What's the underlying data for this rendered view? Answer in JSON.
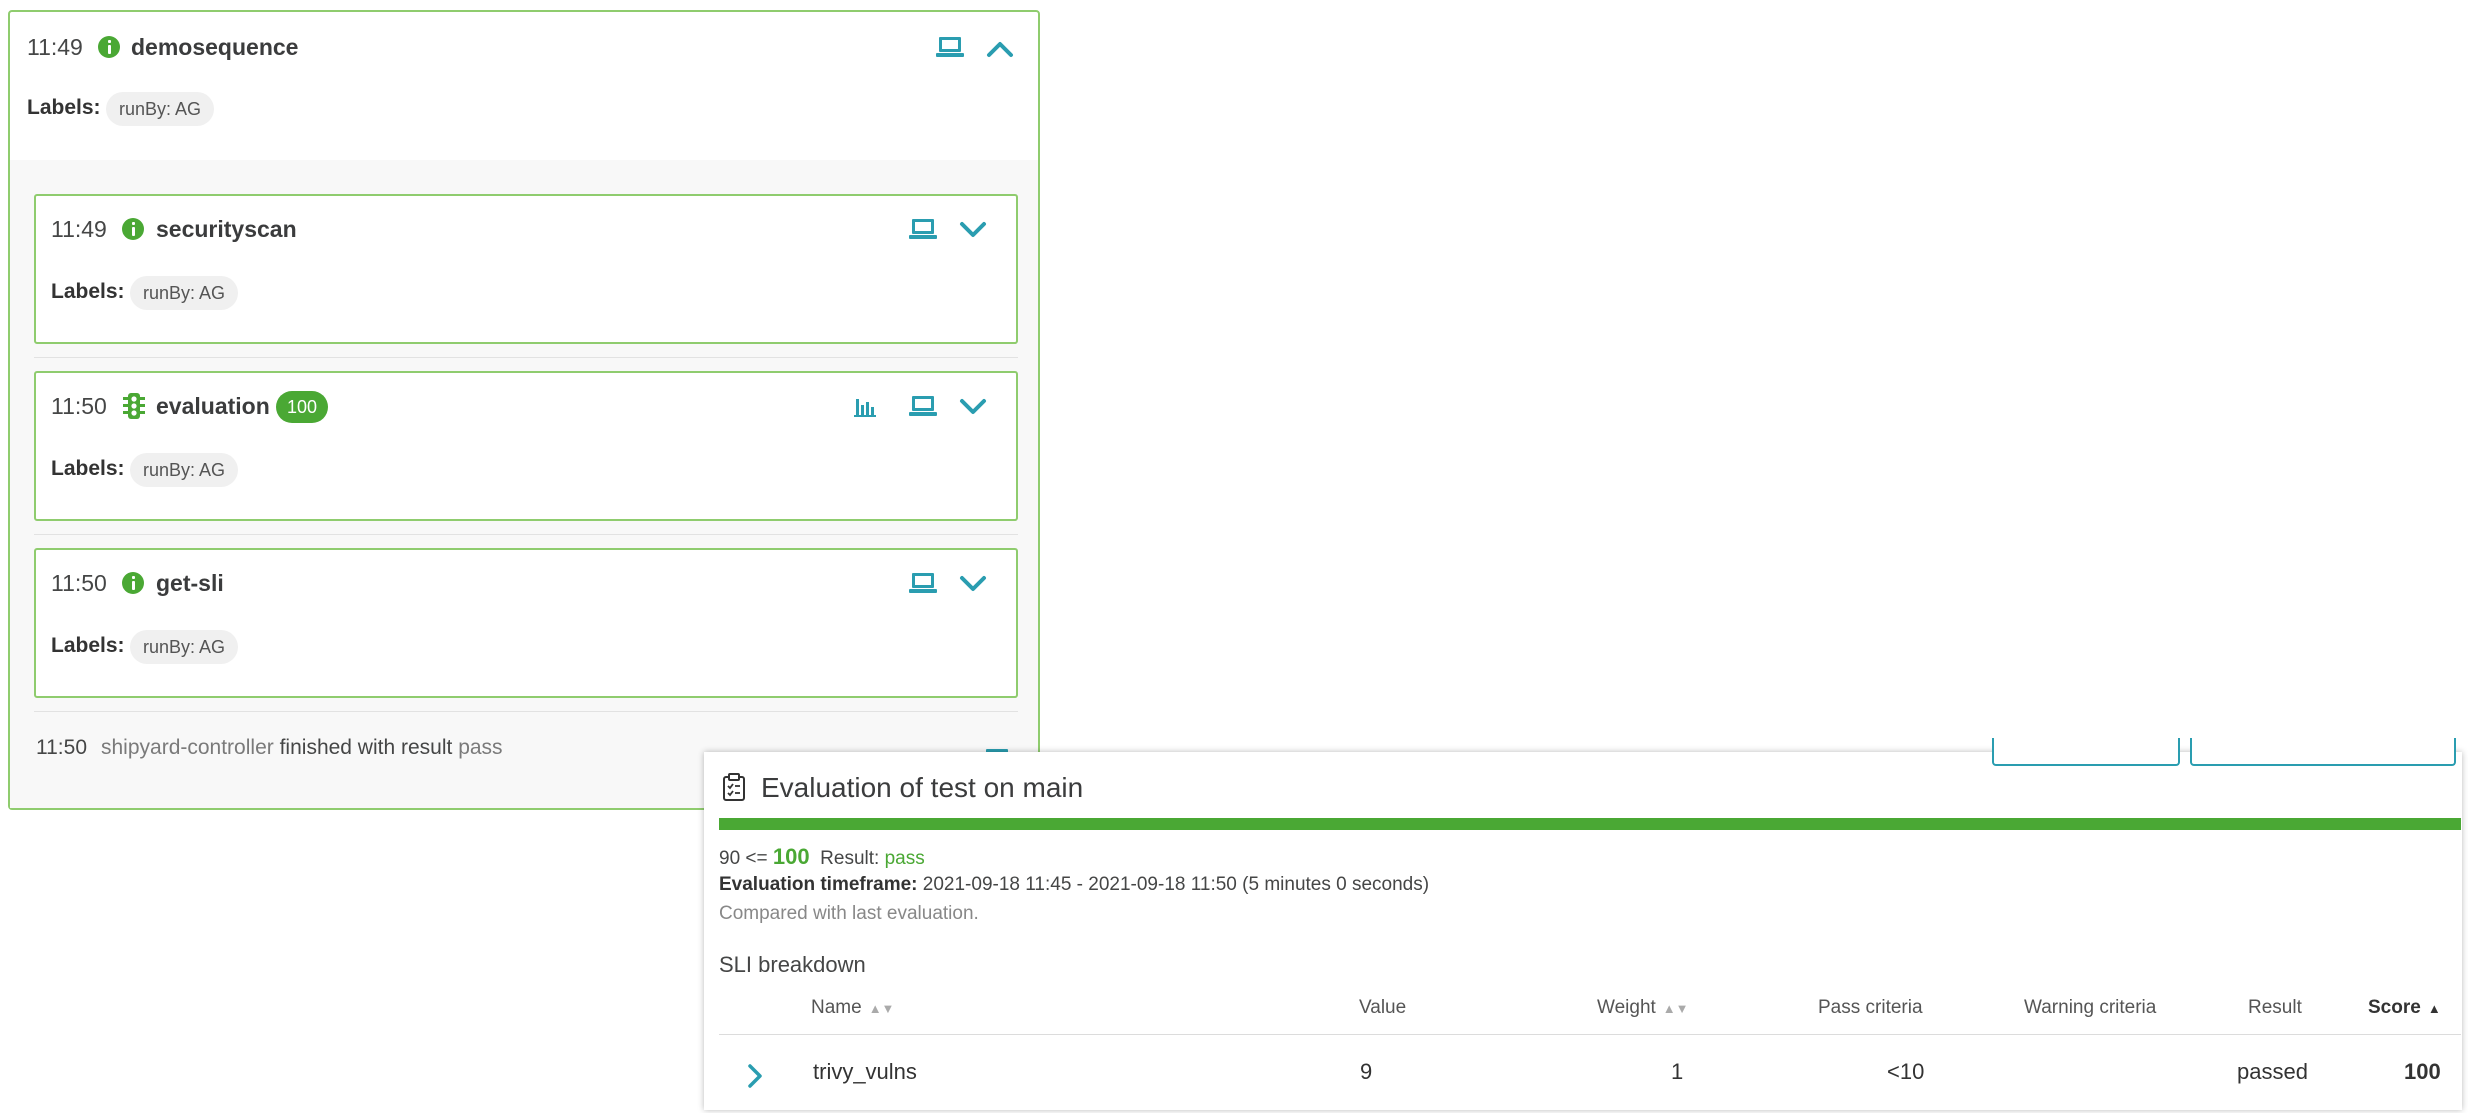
{
  "colors": {
    "accent": "#2a9db0",
    "success": "#4aa834",
    "border": "#8fcc6e"
  },
  "sequence": {
    "time": "11:49",
    "name": "demosequence",
    "labels_key": "Labels:",
    "labels": [
      "runBy: AG"
    ],
    "tasks": [
      {
        "time": "11:49",
        "name": "securityscan",
        "icon": "info-icon",
        "labels_key": "Labels:",
        "labels": [
          "runBy: AG"
        ]
      },
      {
        "time": "11:50",
        "name": "evaluation",
        "icon": "traffic-light-icon",
        "score": "100",
        "labels_key": "Labels:",
        "labels": [
          "runBy: AG"
        ]
      },
      {
        "time": "11:50",
        "name": "get-sli",
        "icon": "info-icon",
        "labels_key": "Labels:",
        "labels": [
          "runBy: AG"
        ]
      }
    ],
    "finished": {
      "time": "11:50",
      "controller": "shipyard-controller",
      "text": "finished with result",
      "result": "pass"
    }
  },
  "evaluation": {
    "title": "Evaluation of test on main",
    "score_threshold": "90 <=",
    "score": "100",
    "result_label": "Result:",
    "result": "pass",
    "score_fraction": 1.0,
    "timeframe_label": "Evaluation timeframe:",
    "timeframe": "2021-09-18 11:45 - 2021-09-18 11:50 (5 minutes 0 seconds)",
    "compared": "Compared with last evaluation.",
    "sli_title": "SLI breakdown",
    "columns": [
      "Name",
      "Value",
      "Weight",
      "Pass criteria",
      "Warning criteria",
      "Result",
      "Score"
    ],
    "rows": [
      {
        "name": "trivy_vulns",
        "value": "9",
        "weight": "1",
        "pass": "<10",
        "warning": "",
        "result": "passed",
        "score": "100"
      }
    ]
  }
}
